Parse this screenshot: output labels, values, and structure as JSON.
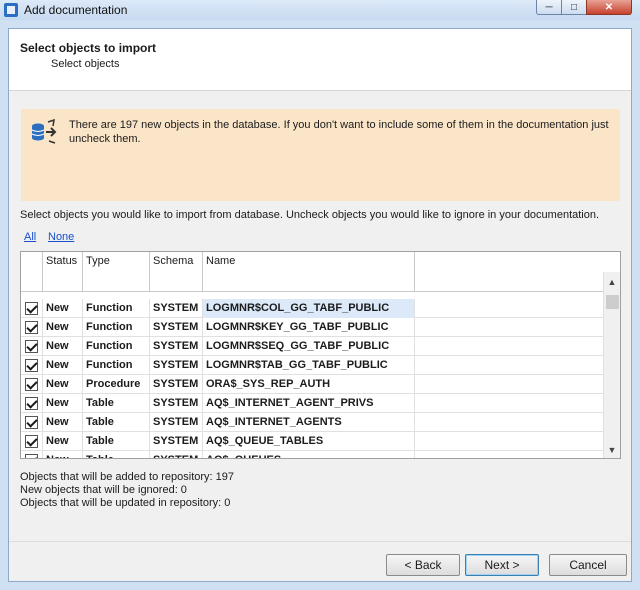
{
  "window": {
    "title": "Add documentation"
  },
  "header": {
    "title": "Select objects to import",
    "subtitle": "Select objects"
  },
  "info": {
    "text": "There are 197 new objects in the database. If you don't want to include some of them in the documentation just uncheck them."
  },
  "instructions": "Select objects you would like to import from database. Uncheck objects you would like to ignore in your documentation.",
  "links": {
    "all": "All",
    "none": "None"
  },
  "grid": {
    "columns": [
      "Status",
      "Type",
      "Schema",
      "Name"
    ],
    "rows": [
      {
        "checked": true,
        "status": "New",
        "type": "Function",
        "schema": "SYSTEM",
        "name": "LOGMNR$COL_GG_TABF_PUBLIC"
      },
      {
        "checked": true,
        "status": "New",
        "type": "Function",
        "schema": "SYSTEM",
        "name": "LOGMNR$KEY_GG_TABF_PUBLIC"
      },
      {
        "checked": true,
        "status": "New",
        "type": "Function",
        "schema": "SYSTEM",
        "name": "LOGMNR$SEQ_GG_TABF_PUBLIC"
      },
      {
        "checked": true,
        "status": "New",
        "type": "Function",
        "schema": "SYSTEM",
        "name": "LOGMNR$TAB_GG_TABF_PUBLIC"
      },
      {
        "checked": true,
        "status": "New",
        "type": "Procedure",
        "schema": "SYSTEM",
        "name": "ORA$_SYS_REP_AUTH"
      },
      {
        "checked": true,
        "status": "New",
        "type": "Table",
        "schema": "SYSTEM",
        "name": "AQ$_INTERNET_AGENT_PRIVS"
      },
      {
        "checked": true,
        "status": "New",
        "type": "Table",
        "schema": "SYSTEM",
        "name": "AQ$_INTERNET_AGENTS"
      },
      {
        "checked": true,
        "status": "New",
        "type": "Table",
        "schema": "SYSTEM",
        "name": "AQ$_QUEUE_TABLES"
      },
      {
        "checked": true,
        "status": "New",
        "type": "Table",
        "schema": "SYSTEM",
        "name": "AQ$_QUEUES"
      }
    ]
  },
  "summary": {
    "added": "Objects that will be added to repository: 197",
    "ignored": "New objects that will be ignored: 0",
    "updated": "Objects that will be updated in repository: 0"
  },
  "buttons": {
    "back": "< Back",
    "next": "Next >",
    "cancel": "Cancel"
  },
  "colors": {
    "info_bg": "#fbe5c9",
    "link": "#1a4fd0",
    "selected_row": "#dbe9f9"
  },
  "icons": {
    "app": "database-doc-icon",
    "info": "database-import-icon"
  }
}
